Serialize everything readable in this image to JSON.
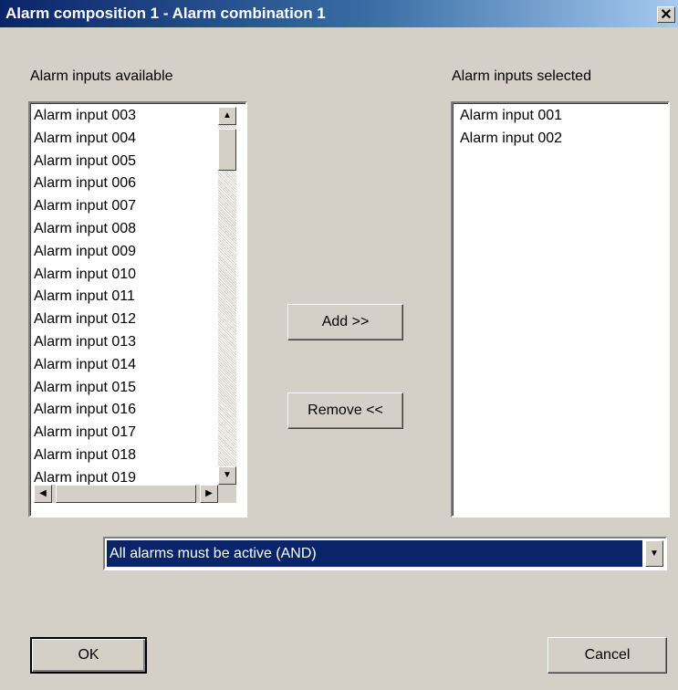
{
  "window": {
    "title": "Alarm composition 1 - Alarm combination 1",
    "close_glyph": "✕"
  },
  "available": {
    "label": "Alarm inputs available",
    "items": [
      "Alarm input 003",
      "Alarm input 004",
      "Alarm input 005",
      "Alarm input 006",
      "Alarm input 007",
      "Alarm input 008",
      "Alarm input 009",
      "Alarm input 010",
      "Alarm input 011",
      "Alarm input 012",
      "Alarm input 013",
      "Alarm input 014",
      "Alarm input 015",
      "Alarm input 016",
      "Alarm input 017",
      "Alarm input 018",
      "Alarm input 019"
    ]
  },
  "selected": {
    "label": "Alarm inputs selected",
    "items": [
      "Alarm input 001",
      "Alarm input 002"
    ]
  },
  "buttons": {
    "add": "Add >>",
    "remove": "Remove <<",
    "ok": "OK",
    "cancel": "Cancel"
  },
  "mode": {
    "selected": "All alarms must be active (AND)"
  },
  "icons": {
    "up": "▲",
    "down": "▼",
    "left": "◀",
    "right": "▶"
  },
  "colors": {
    "title_bar_start": "#0a246a",
    "title_bar_end": "#a6caf0",
    "selection": "#0a246a",
    "dialog_bg": "#d4d0c8"
  }
}
